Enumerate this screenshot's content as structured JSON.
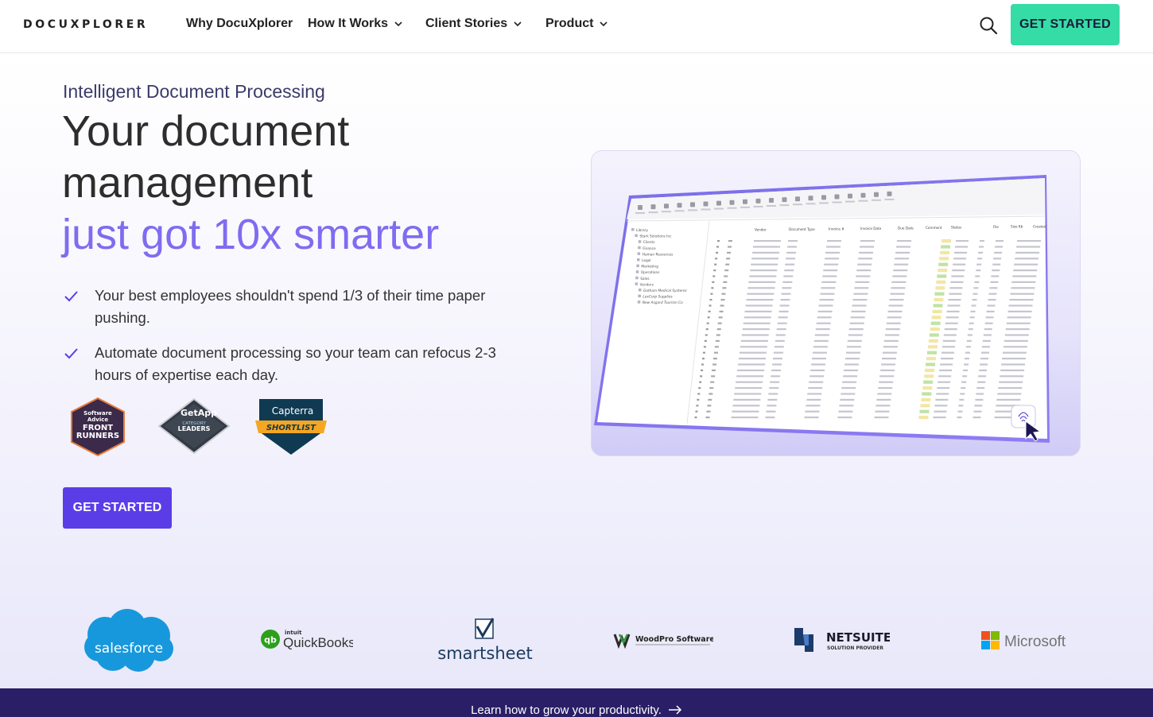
{
  "header": {
    "logo": "DOCUXPLORER",
    "nav": [
      {
        "label": "Why DocuXplorer"
      },
      {
        "label": "How It Works"
      },
      {
        "label": "Client Stories"
      },
      {
        "label": "Product"
      }
    ],
    "cta": "GET STARTED"
  },
  "hero": {
    "eyebrow": "Intelligent Document Processing",
    "title_line1": "Your document",
    "title_line2": "management",
    "title_accent": "just got 10x smarter",
    "bullets": [
      "Your best employees shouldn't spend 1/3 of their time paper pushing.",
      "Automate document processing so your team can refocus 2-3 hours of expertise each day."
    ],
    "badges": [
      {
        "top": "Software",
        "mid": "Advice",
        "line1": "FRONT",
        "line2": "RUNNERS"
      },
      {
        "brand": "GetApp",
        "line1": "CATEGORY",
        "line2": "LEADERS"
      },
      {
        "brand": "Capterra",
        "ribbon": "SHORTLIST"
      }
    ],
    "cta": "GET STARTED"
  },
  "app_preview": {
    "columns": [
      "Vendor",
      "Document Type",
      "Invoice #",
      "Invoice Date",
      "Due Date",
      "Comment",
      "Status",
      "File",
      "Size Kb",
      "Created"
    ],
    "tree": [
      "Library",
      "Stark Solutions Inc",
      "Clients",
      "Finance",
      "Human Resources",
      "Legal",
      "Marketing",
      "Operations",
      "Sales",
      "Vendors",
      "Gotham Medical Systems",
      "LexCorp Supplies",
      "New Asgard Tourism Co"
    ]
  },
  "logos": {
    "salesforce": "salesforce",
    "quickbooks_small": "intuit",
    "quickbooks": "QuickBooks.",
    "smartsheet": "smartsheet",
    "woodpro": "WoodPro Software",
    "netsuite": "NETSUITE",
    "netsuite_sub": "SOLUTION PROVIDER",
    "microsoft": "Microsoft"
  },
  "footer": {
    "link": "Learn how to grow your productivity."
  },
  "colors": {
    "accent_purple": "#7f6cf0",
    "primary_button": "#5b3de8",
    "top_button": "#36dca6",
    "footer_strip": "#2a1f66"
  }
}
